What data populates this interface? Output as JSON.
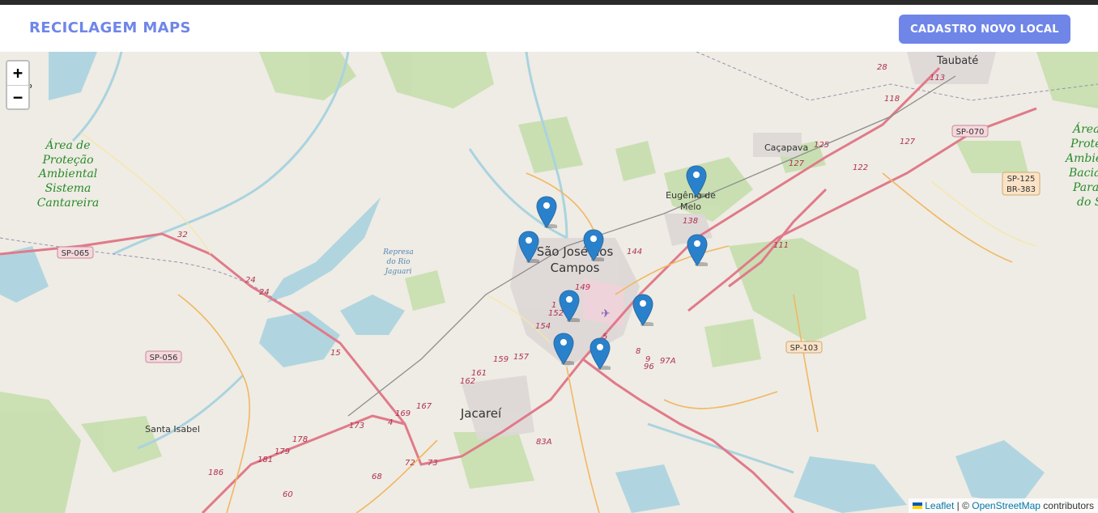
{
  "navbar": {
    "brand": "RECICLAGEM MAPS",
    "cta_label": "CADASTRO NOVO LOCAL",
    "accent_color": "#6f86e8"
  },
  "map": {
    "zoom_in_label": "+",
    "zoom_out_label": "−",
    "marker_icon": "map-pin-icon",
    "marker_color": "#2a81cb",
    "marker_count": 9,
    "labels": {
      "taubate": "Taubaté",
      "cacapava": "Caçapava",
      "eugenio1": "Eugênio de",
      "eugenio2": "Melo",
      "sjc1": "São José dos",
      "sjc2": "Campos",
      "jacarei": "Jacareí",
      "santa_isabel": "Santa Isabel",
      "represa1": "Represa",
      "represa2": "do Rio",
      "represa3": "Jaguari",
      "apa_left": [
        "Área de",
        "Proteção",
        "Ambiental",
        "Sistema",
        "Cantareira"
      ],
      "apa_right": [
        "Área",
        "Prote",
        "Ambie",
        "Bacia",
        "Para",
        "do S"
      ],
      "partial_top_left": "P"
    },
    "shields": {
      "sp065": "SP-065",
      "sp056": "SP-056",
      "sp070": "SP-070",
      "sp125": "SP-125",
      "br383": "BR-383",
      "sp103": "SP-103"
    },
    "road_numbers": [
      "28",
      "113",
      "118",
      "125",
      "127",
      "127",
      "122",
      "138",
      "144",
      "149",
      "152",
      "154",
      "157",
      "159",
      "161",
      "162",
      "167",
      "169",
      "4",
      "173",
      "178",
      "179",
      "181",
      "186",
      "60",
      "68",
      "72",
      "73",
      "83A",
      "8",
      "9",
      "97A",
      "96",
      "5",
      "1",
      "111",
      "32",
      "24",
      "24",
      "15"
    ]
  },
  "attribution": {
    "leaflet": "Leaflet",
    "separator": " | © ",
    "osm": "OpenStreetMap",
    "suffix": " contributors"
  }
}
